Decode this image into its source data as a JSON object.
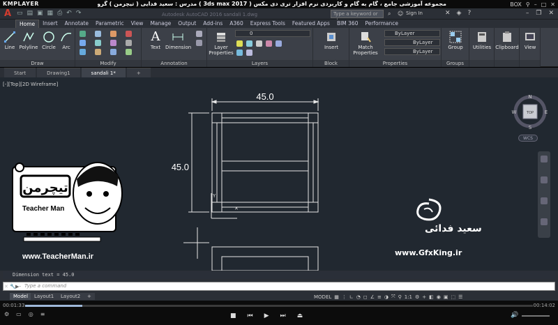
{
  "player": {
    "logo": "KMPLAYER",
    "caption": "مجموعه آموزشی جامع ، گام به گام و کاربردی نرم افزار تری دی مکس ( 3ds max 2017 )  مدرس : سعید فدایی ( تیچرمن ) گروه آموزشی پادشاه گرافیست ها",
    "top_right": "BOX",
    "time_current": "00:01:33",
    "time_total": "00:14:02"
  },
  "acad": {
    "doc_title": "Autodesk AutoCAD 2016   sandali 1.dwg",
    "search_placeholder": "Type a keyword or phrase",
    "sign_in": "Sign In",
    "ribbon_tabs": [
      "Home",
      "Insert",
      "Annotate",
      "Parametric",
      "View",
      "Manage",
      "Output",
      "Add-ins",
      "A360",
      "Express Tools",
      "Featured Apps",
      "BIM 360",
      "Performance"
    ],
    "active_tab": "Home",
    "tools": {
      "line": "Line",
      "polyline": "Polyline",
      "circle": "Circle",
      "arc": "Arc",
      "text": "Text",
      "dimension": "Dimension",
      "layer_props": "Layer Properties",
      "insert": "Insert",
      "match_props": "Match Properties",
      "group": "Group",
      "utilities": "Utilities",
      "clipboard": "Clipboard",
      "view": "View",
      "layer_value": "0",
      "bylayer1": "ByLayer",
      "bylayer2": "ByLayer",
      "bylayer3": "ByLayer"
    },
    "panels": [
      "Draw",
      "Modify",
      "Annotation",
      "Layers",
      "Block",
      "Properties",
      "Groups"
    ],
    "file_tabs": [
      "Start",
      "Drawing1",
      "sandali 1*"
    ],
    "active_file_tab": "sandali 1*",
    "view_label": "[-][Top][2D Wireframe]",
    "drawing": {
      "dim_horizontal": "45.0",
      "dim_vertical": "45.0"
    },
    "navcube": {
      "n": "N",
      "s": "S",
      "e": "E",
      "w": "W",
      "top": "TOP",
      "wcs": "WCS"
    },
    "command_history": "Dimension text = 45.0",
    "command_placeholder": "Type a command",
    "layout_tabs": [
      "Model",
      "Layout1",
      "Layout2"
    ],
    "status": {
      "model": "MODEL",
      "scale": "1:1"
    }
  },
  "watermarks": {
    "teacher_name": "Teacher Man",
    "teacher_url": "www.TeacherMan.ir",
    "gfx_name": "سعید فدائی",
    "gfx_url": "www.GfxKing.ir"
  }
}
